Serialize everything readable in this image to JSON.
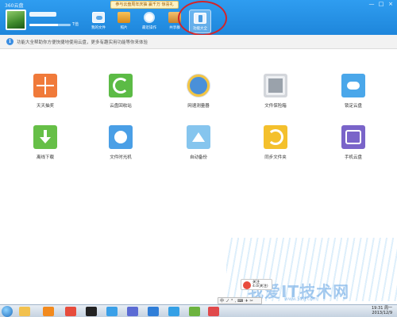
{
  "window": {
    "title": "360云盘",
    "controls": [
      "—",
      "□",
      "×"
    ]
  },
  "promo": "参与云盘周年庆抽 赢千万 惊喜礼",
  "storage": {
    "text": "T值",
    "fill": 0.7
  },
  "toolbar": {
    "items": [
      {
        "label": "我的文件",
        "icon": "cloud-folder-icon",
        "active": false
      },
      {
        "label": "照片",
        "icon": "photo-icon",
        "active": false
      },
      {
        "label": "最近操作",
        "icon": "clock-icon",
        "active": false
      },
      {
        "label": "共享群",
        "icon": "share-group-icon",
        "active": false
      },
      {
        "label": "功能大全",
        "icon": "toolbox-icon",
        "active": true
      }
    ]
  },
  "info_bar": {
    "text": "功能大全帮助你方便快捷地使用云盘，更多有趣实用功能等你来体验"
  },
  "features": [
    {
      "label": "天天抽奖",
      "icon": "lottery-icon",
      "color": "#f07a3a"
    },
    {
      "label": "云盘回收站",
      "icon": "recycle-bin-icon",
      "color": "#5cbb46"
    },
    {
      "label": "网速测量器",
      "icon": "speedometer-icon",
      "color": "#4a90d9"
    },
    {
      "label": "文件保险箱",
      "icon": "safe-icon",
      "color": "#9aa2ab"
    },
    {
      "label": "锁定云盘",
      "icon": "cloud-lock-icon",
      "color": "#4aa7ea"
    },
    {
      "label": "离线下载",
      "icon": "download-icon",
      "color": "#66bf47"
    },
    {
      "label": "文件时光机",
      "icon": "time-machine-icon",
      "color": "#4a9fe6"
    },
    {
      "label": "自动备份",
      "icon": "upload-backup-icon",
      "color": "#86c5ee"
    },
    {
      "label": "同步文件夹",
      "icon": "sync-folder-icon",
      "color": "#f4c02c"
    },
    {
      "label": "手机云盘",
      "icon": "phone-cloud-icon",
      "color": "#7a64c9"
    }
  ],
  "popup": {
    "line1": "关注",
    "line2": "4.0(关注)"
  },
  "ime": [
    "中",
    "ノ",
    "°",
    ",",
    "⌨",
    "✈",
    "✂"
  ],
  "watermark": {
    "text": "我爱IT技术网",
    "url": "www.52ij.com"
  },
  "taskbar": {
    "time": "19:31 周一",
    "date": "2013/12/9",
    "apps": [
      {
        "icon": "explorer-icon",
        "color": "#f2c14e"
      },
      {
        "icon": "media-player-icon",
        "color": "#f28a1e"
      },
      {
        "icon": "chrome-icon",
        "color": "#e74c3c"
      },
      {
        "icon": "qq-icon",
        "color": "#222222"
      },
      {
        "icon": "browser-icon",
        "color": "#3aa0e8"
      },
      {
        "icon": "fish-icon",
        "color": "#5b6bd4"
      },
      {
        "icon": "plane-icon",
        "color": "#2f7ed8"
      },
      {
        "icon": "cloud-drive-icon",
        "color": "#34a0e6"
      },
      {
        "icon": "chat-icon",
        "color": "#6cb33f"
      },
      {
        "icon": "circle-icon",
        "color": "#e0494b"
      }
    ]
  }
}
